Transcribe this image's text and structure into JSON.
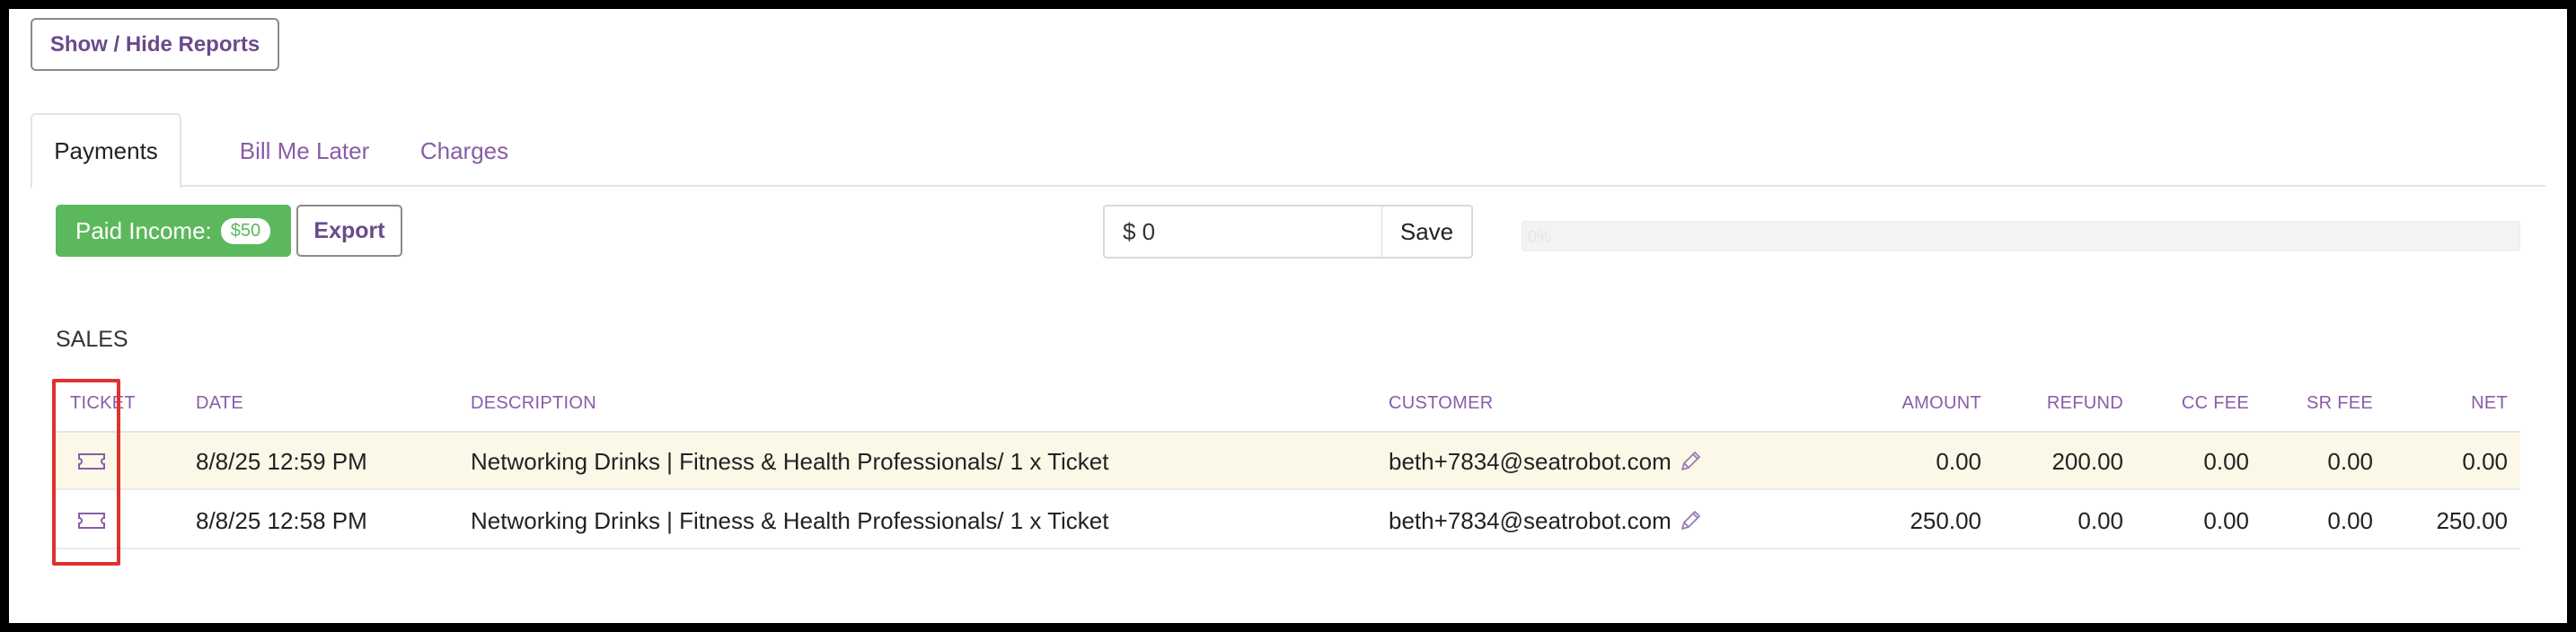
{
  "toolbar": {
    "show_hide_reports": "Show / Hide Reports"
  },
  "tabs": [
    {
      "label": "Payments",
      "active": true
    },
    {
      "label": "Bill Me Later",
      "active": false
    },
    {
      "label": "Charges",
      "active": false
    }
  ],
  "actions": {
    "paid_income_label": "Paid Income:",
    "paid_income_value": "$50",
    "export_label": "Export",
    "amount_value": "$ 0",
    "save_label": "Save",
    "progress_percent": 0,
    "progress_text": "0%"
  },
  "sales": {
    "title": "SALES",
    "columns": [
      "TICKET",
      "DATE",
      "DESCRIPTION",
      "CUSTOMER",
      "AMOUNT",
      "REFUND",
      "CC FEE",
      "SR FEE",
      "NET"
    ],
    "rows": [
      {
        "date": "8/8/25 12:59 PM",
        "description": "Networking Drinks | Fitness & Health Professionals/ 1 x Ticket",
        "customer": "beth+7834@seatrobot.com",
        "amount": "0.00",
        "refund": "200.00",
        "cc_fee": "0.00",
        "sr_fee": "0.00",
        "net": "0.00"
      },
      {
        "date": "8/8/25 12:58 PM",
        "description": "Networking Drinks | Fitness & Health Professionals/ 1 x Ticket",
        "customer": "beth+7834@seatrobot.com",
        "amount": "250.00",
        "refund": "0.00",
        "cc_fee": "0.00",
        "sr_fee": "0.00",
        "net": "250.00"
      }
    ]
  },
  "colors": {
    "accent_purple": "#8a5ca8",
    "success_green": "#5cb85c",
    "highlight_red": "#e0322d",
    "row_highlight": "#fcf8e8"
  },
  "icons": {
    "ticket": "ticket-icon",
    "edit": "pencil-icon"
  }
}
